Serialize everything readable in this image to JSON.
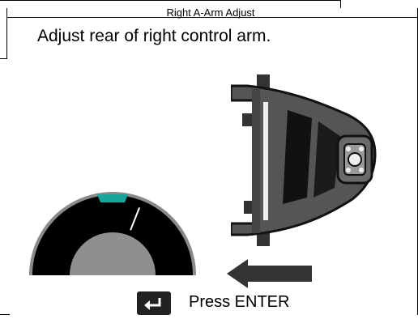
{
  "screen": {
    "title": "Right A-Arm Adjust",
    "instruction": "Adjust rear of right control arm.",
    "prompt": {
      "key_icon": "enter-key-icon",
      "label": "Press ENTER"
    }
  },
  "gauge": {
    "needle_fraction": 0.62,
    "colors": {
      "dial": "#000000",
      "rim": "#8a8a8a",
      "hub": "#8f8f8f",
      "target_marker": "#1aa59a",
      "needle": "#ffffff"
    }
  },
  "graphic": {
    "part_icon": "a-arm-bracket-icon",
    "direction_icon": "arrow-left-icon",
    "colors": {
      "part": "#555555",
      "arrow": "#333333"
    }
  }
}
